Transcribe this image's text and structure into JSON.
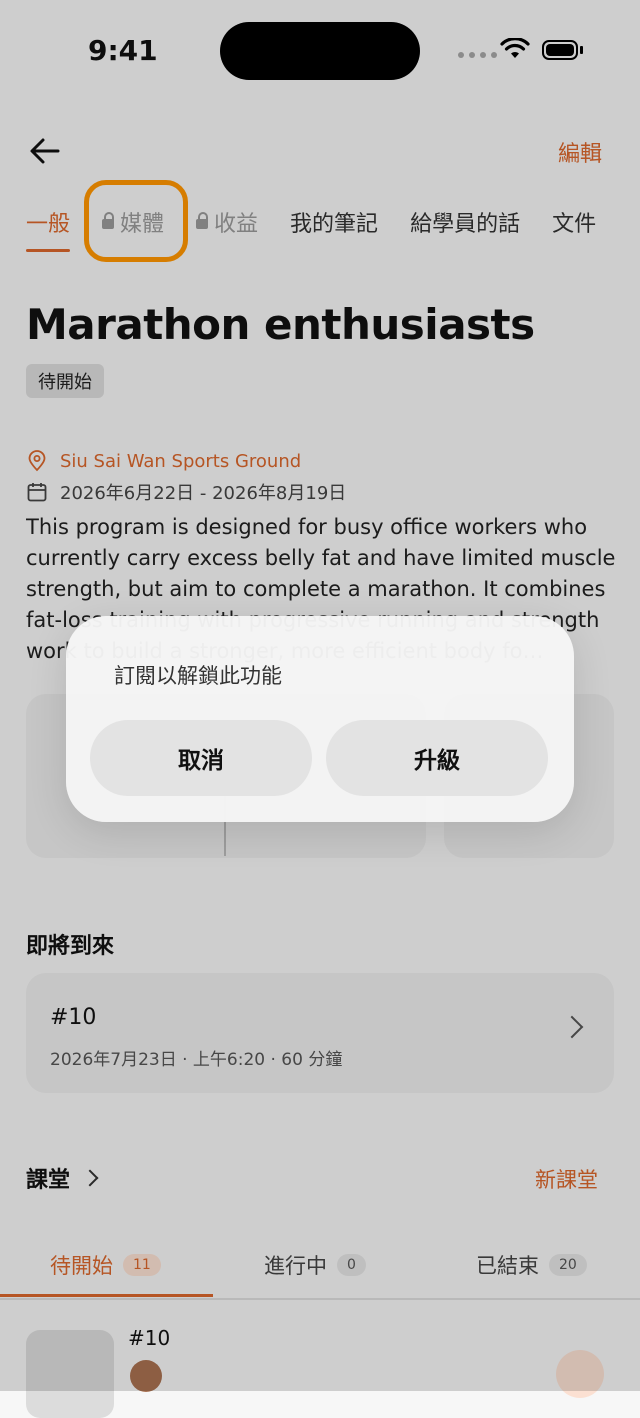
{
  "status_bar": {
    "time": "9:41"
  },
  "header": {
    "edit_label": "編輯"
  },
  "tabs": [
    {
      "label": "一般",
      "active": true,
      "locked": false
    },
    {
      "label": "媒體",
      "active": false,
      "locked": true
    },
    {
      "label": "收益",
      "active": false,
      "locked": true
    },
    {
      "label": "我的筆記",
      "active": false,
      "locked": false
    },
    {
      "label": "給學員的話",
      "active": false,
      "locked": false
    },
    {
      "label": "文件",
      "active": false,
      "locked": false
    }
  ],
  "program": {
    "title": "Marathon enthusiasts",
    "status": "待開始",
    "location": "Siu Sai Wan Sports Ground",
    "date_range": "2026年6月22日 - 2026年8月19日",
    "description": "This program is designed for busy office workers who currently carry excess belly fat and have limited muscle strength, but aim to complete a marathon. It combines fat-loss training with progressive running and strength work to build a stronger, more efficient body fo…"
  },
  "upcoming": {
    "heading": "即將到來",
    "item": {
      "number": "#10",
      "meta": "2026年7月23日 · 上午6:20 · 60 分鐘"
    }
  },
  "classes": {
    "heading": "課堂",
    "new_label": "新課堂",
    "subtabs": [
      {
        "label": "待開始",
        "count": "11",
        "active": true
      },
      {
        "label": "進行中",
        "count": "0",
        "active": false
      },
      {
        "label": "已結束",
        "count": "20",
        "active": false
      }
    ],
    "first_item": {
      "number": "#10"
    }
  },
  "alert": {
    "message": "訂閱以解鎖此功能",
    "cancel_label": "取消",
    "upgrade_label": "升級"
  },
  "colors": {
    "accent": "#d9662b",
    "highlight": "#ff9500"
  }
}
